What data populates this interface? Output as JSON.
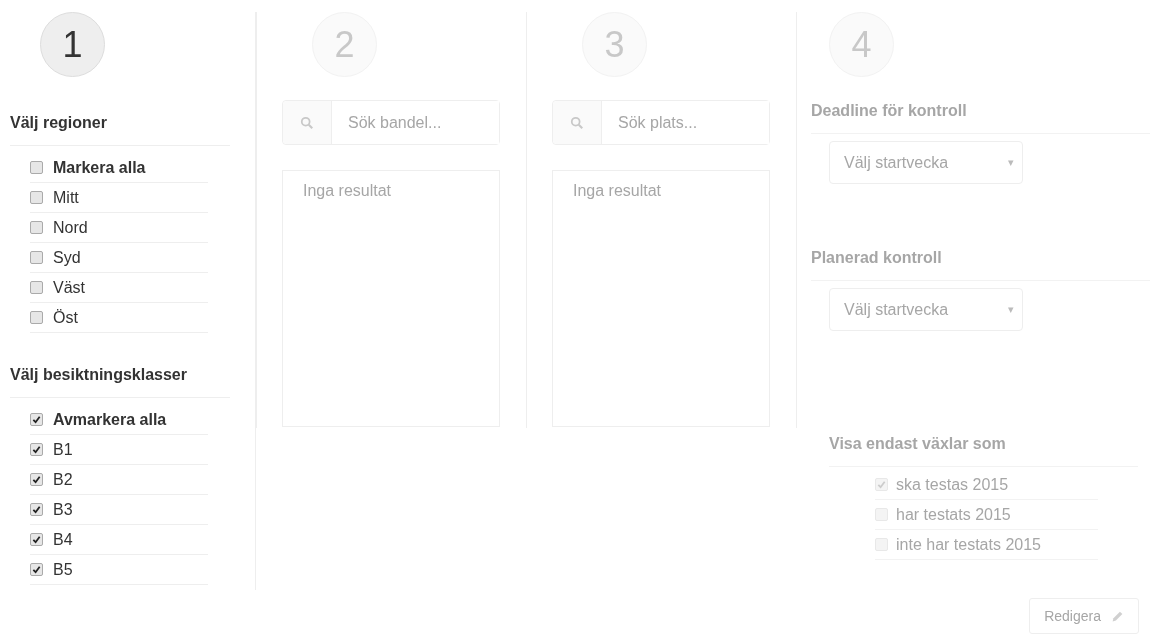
{
  "columns": [
    {
      "step": {
        "number": "1",
        "disabled": false
      },
      "sections": [
        {
          "heading": "Välj regioner",
          "items": [
            {
              "label": "Markera alla",
              "kind": "all",
              "checked": false
            },
            {
              "label": "Mitt",
              "kind": "option",
              "checked": false
            },
            {
              "label": "Nord",
              "kind": "option",
              "checked": false
            },
            {
              "label": "Syd",
              "kind": "option",
              "checked": false
            },
            {
              "label": "Väst",
              "kind": "option",
              "checked": false
            },
            {
              "label": "Öst",
              "kind": "option",
              "checked": false
            }
          ]
        },
        {
          "heading": "Välj besiktningsklasser",
          "items": [
            {
              "label": "Avmarkera alla",
              "kind": "all",
              "checked": true
            },
            {
              "label": "B1",
              "kind": "option",
              "checked": true
            },
            {
              "label": "B2",
              "kind": "option",
              "checked": true
            },
            {
              "label": "B3",
              "kind": "option",
              "checked": true
            },
            {
              "label": "B4",
              "kind": "option",
              "checked": true
            },
            {
              "label": "B5",
              "kind": "option",
              "checked": true
            }
          ]
        }
      ]
    },
    {
      "step": {
        "number": "2",
        "disabled": true
      },
      "search": {
        "placeholder": "Sök bandel..."
      },
      "results": {
        "empty_text": "Inga resultat"
      }
    },
    {
      "step": {
        "number": "3",
        "disabled": true
      },
      "search": {
        "placeholder": "Sök plats..."
      },
      "results": {
        "empty_text": "Inga resultat"
      }
    }
  ],
  "schedule": {
    "step": {
      "number": "4",
      "disabled": true
    },
    "selects": [
      {
        "heading": "Deadline för kontroll",
        "placeholder": "Välj startvecka",
        "arrow": "▾"
      },
      {
        "heading": "Planerad kontroll",
        "placeholder": "Välj startvecka",
        "arrow": "▾"
      }
    ],
    "filter": {
      "heading": "Visa endast växlar som",
      "disabled": true,
      "items": [
        {
          "label": "ska testas 2015",
          "checked": true
        },
        {
          "label": "har testats 2015",
          "checked": false
        },
        {
          "label": "inte har testats 2015",
          "checked": false
        }
      ]
    },
    "edit_button": {
      "label": "Redigera",
      "disabled": true
    }
  }
}
